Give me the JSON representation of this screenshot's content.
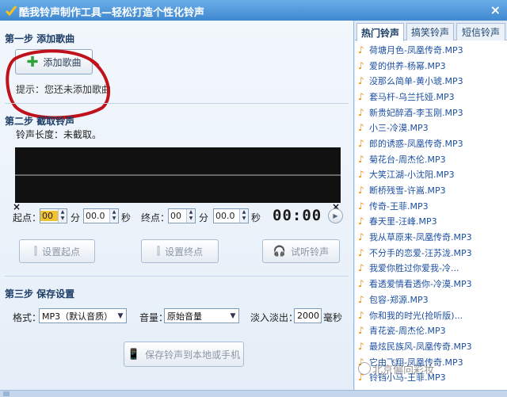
{
  "title": "酷我铃声制作工具—轻松打造个性化铃声",
  "step1": {
    "title": "第一步 添加歌曲",
    "add_button": "添加歌曲",
    "hint_prefix": "提示：",
    "hint": "您还未添加歌曲"
  },
  "step2": {
    "title": "第二步 截取铃声",
    "length_label": "铃声长度：",
    "length_value": "未截取。",
    "start_label": "起点：",
    "end_label": "终点：",
    "start_min": "00",
    "start_sec": "00.0",
    "end_min": "00",
    "end_sec": "00.0",
    "min_unit": "分",
    "sec_unit": "秒",
    "time_display": "00:00",
    "wave_marker": "×",
    "set_start_button": "设置起点",
    "set_end_button": "设置终点",
    "preview_button": "试听铃声"
  },
  "step3": {
    "title": "第三步 保存设置",
    "format_label": "格式：",
    "format_value": "MP3（默认音质）",
    "volume_label": "音量：",
    "volume_value": "原始音量",
    "fade_label": "淡入淡出：",
    "fade_value": "2000",
    "fade_unit": "毫秒",
    "save_button": "保存铃声到本地或手机"
  },
  "tabs": [
    "热门铃声",
    "搞笑铃声",
    "短信铃声"
  ],
  "songs": [
    "荷塘月色-凤凰传奇.MP3",
    "爱的供养-杨幂.MP3",
    "没那么简单-黄小琥.MP3",
    "套马杆-乌兰托娅.MP3",
    "新贵妃醉酒-李玉刚.MP3",
    "小三-冷漠.MP3",
    "郎的诱惑-凤凰传奇.MP3",
    "菊花台-周杰伦.MP3",
    "大笑江湖-小沈阳.MP3",
    "断桥残雪-许嵩.MP3",
    "传奇-王菲.MP3",
    "春天里-汪峰.MP3",
    "我从草原来-凤凰传奇.MP3",
    "不分手的恋爱-汪苏泷.MP3",
    "我爱你胜过你爱我-冷...",
    "看透爱情看透你-冷漠.MP3",
    "包容-郑源.MP3",
    "你和我的时光(抢听版)...",
    "青花瓷-周杰伦.MP3",
    "最炫民族风-凤凰传奇.MP3",
    "它由飞翔-凤凰传奇.MP3",
    "铃铛小马-王菲.MP3"
  ],
  "watermark": "北京偏向彩妆",
  "icons": {
    "logo": "kuwo-logo-icon",
    "close": "close-icon",
    "add": "plus-icon",
    "note": "music-note-icon",
    "play": "play-icon"
  },
  "colors": {
    "accent": "#3f88d0",
    "song_link": "#1c4fa3",
    "note": "#f28c00",
    "annotation": "#c0121a"
  }
}
